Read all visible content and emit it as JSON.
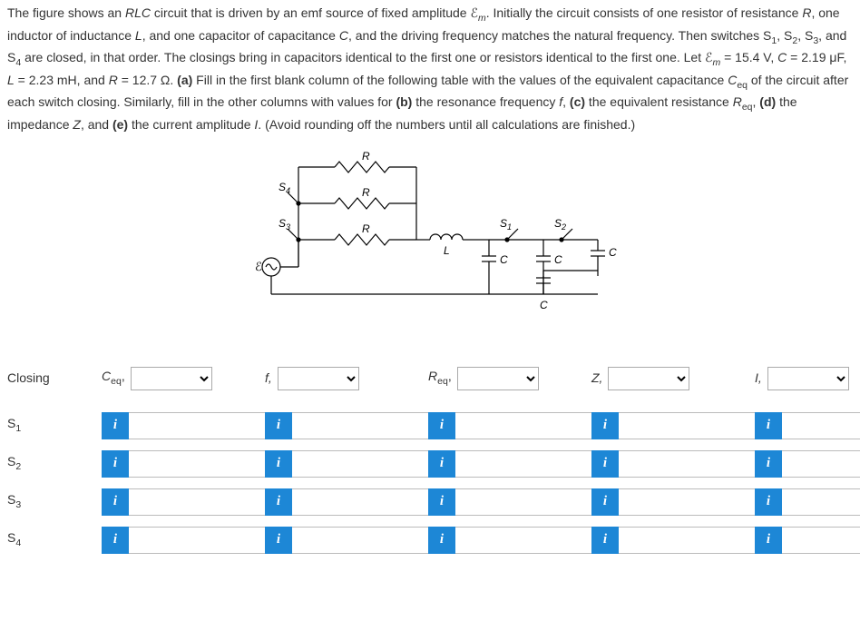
{
  "problem_text": "The figure shows an RLC circuit that is driven by an emf source of fixed amplitude ℰm. Initially the circuit consists of one resistor of resistance R, one inductor of inductance L, and one capacitor of capacitance C, and the driving frequency matches the natural frequency. Then switches S1, S2, S3, and S4 are closed, in that order. The closings bring in capacitors identical to the first one or resistors identical to the first one. Let ℰm = 15.4 V, C = 2.19 μF, L = 2.23 mH, and R = 12.7 Ω. (a) Fill in the first blank column of the following table with the values of the equivalent capacitance Ceq of the circuit after each switch closing. Similarly, fill in the other columns with values for (b) the resonance frequency f, (c) the equivalent resistance Req, (d) the impedance Z, and (e) the current amplitude I. (Avoid rounding off the numbers until all calculations are finished.)",
  "circuit": {
    "labels": {
      "R": "R",
      "L": "L",
      "C": "C",
      "S1": "S1",
      "S2": "S2",
      "S3": "S3",
      "S4": "S4",
      "emf": "ℰ"
    }
  },
  "headers": {
    "closing": "Closing",
    "ceq": "Ceq,",
    "f": "f,",
    "req": "Req,",
    "z": "Z,",
    "i": "I,"
  },
  "rows": [
    {
      "label": "S1"
    },
    {
      "label": "S2"
    },
    {
      "label": "S3"
    },
    {
      "label": "S4"
    }
  ],
  "info_glyph": "i"
}
